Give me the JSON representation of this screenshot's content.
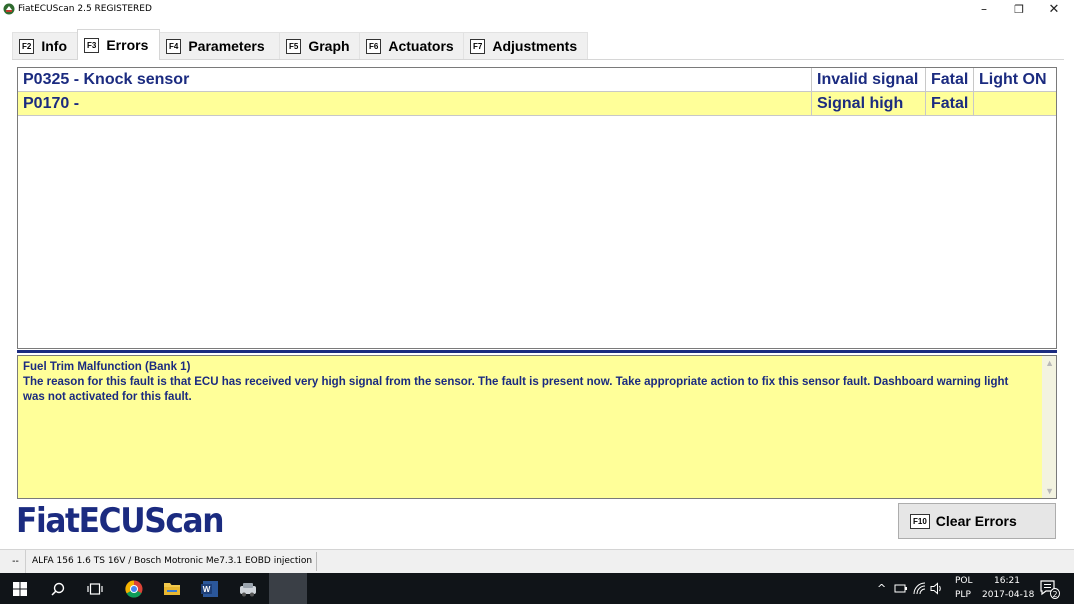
{
  "window": {
    "title": "FiatECUScan 2.5 REGISTERED",
    "controls": {
      "minimize": "–",
      "maximize": "❐",
      "close": "✕"
    }
  },
  "tabs": [
    {
      "key": "F2",
      "label": "Info"
    },
    {
      "key": "F3",
      "label": "Errors"
    },
    {
      "key": "F4",
      "label": "Parameters"
    },
    {
      "key": "F5",
      "label": "Graph"
    },
    {
      "key": "F6",
      "label": "Actuators"
    },
    {
      "key": "F7",
      "label": "Adjustments"
    }
  ],
  "active_tab": "Errors",
  "errors": [
    {
      "code_desc": "P0325 - Knock sensor",
      "status": "Invalid signal",
      "severity": "Fatal",
      "light": "Light ON"
    },
    {
      "code_desc": "P0170 -",
      "status": "Signal high",
      "severity": "Fatal",
      "light": ""
    }
  ],
  "description": {
    "title": "Fuel Trim Malfunction (Bank 1)",
    "body": "The reason for this fault is that ECU has received very high signal from the sensor. The fault is present now. Take appropriate action to fix this sensor fault. Dashboard warning light was not activated for this fault."
  },
  "logo_text": "FiatECUScan",
  "clear_button": {
    "key": "F10",
    "label": "Clear Errors"
  },
  "statusbar": {
    "connection": "--",
    "vehicle": "ALFA 156 1.6 TS 16V / Bosch Motronic Me7.3.1 EOBD injection"
  },
  "taskbar": {
    "language": "POL",
    "layout": "PLP",
    "time": "16:21",
    "date": "2017-04-18",
    "notifications": "2"
  },
  "colors": {
    "accent_navy": "#1b2b80",
    "highlight_yellow": "#ffff99"
  }
}
